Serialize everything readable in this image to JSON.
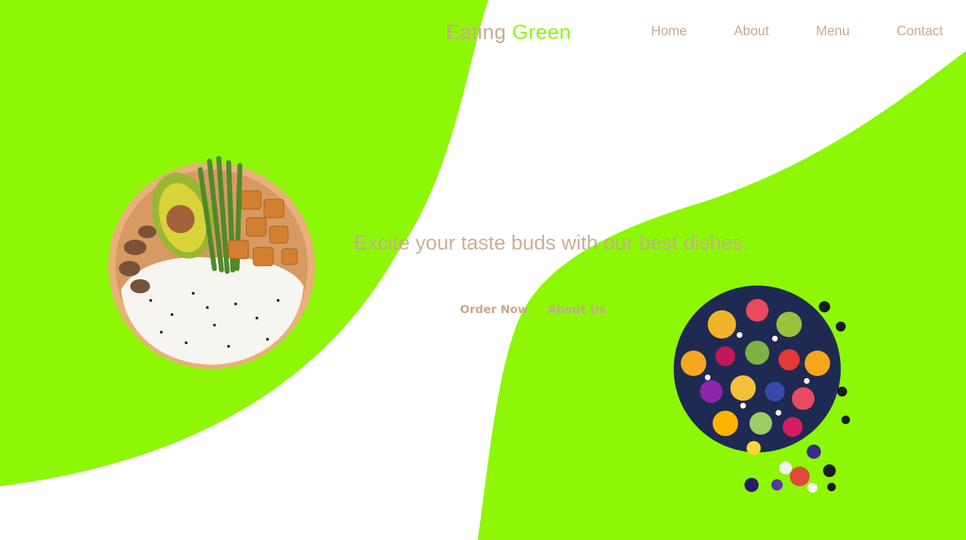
{
  "brand": {
    "word_a": "Eating",
    "word_b": "Green"
  },
  "nav": {
    "items": [
      {
        "label": "Home"
      },
      {
        "label": "About"
      },
      {
        "label": "Menu"
      },
      {
        "label": "Contact"
      }
    ]
  },
  "hero": {
    "headline": "Excite your taste buds with our best dishes.",
    "primary_button": "Order Now",
    "secondary_button": "About Us"
  },
  "colors": {
    "accent_green": "#8df706",
    "text_tan": "#c9a98a",
    "background": "#ffffff"
  },
  "images": {
    "left": "poke-bowl-image",
    "right": "fruit-platter-image"
  }
}
